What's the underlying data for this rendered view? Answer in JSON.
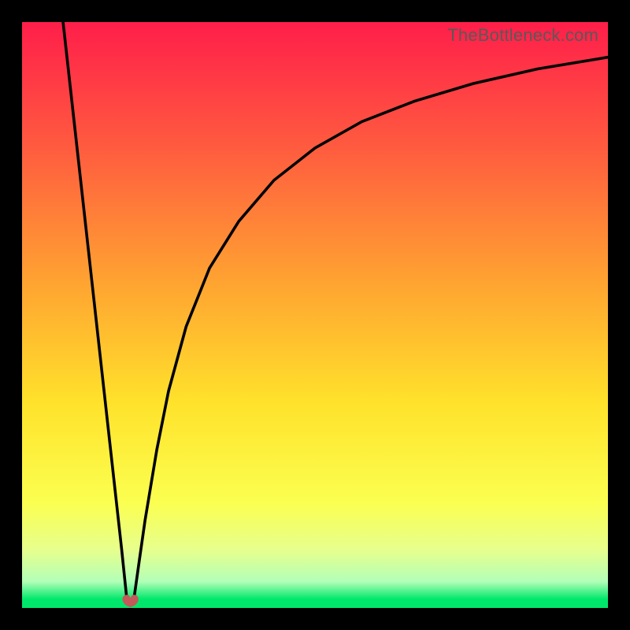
{
  "watermark": "TheBottleneck.com",
  "chart_data": {
    "type": "line",
    "title": "",
    "xlabel": "",
    "ylabel": "",
    "xlim": [
      0,
      100
    ],
    "ylim": [
      0,
      100
    ],
    "grid": false,
    "legend": false,
    "background_gradient": {
      "stops": [
        {
          "pos": 0.0,
          "color": "#ff1e4a"
        },
        {
          "pos": 0.2,
          "color": "#ff5740"
        },
        {
          "pos": 0.45,
          "color": "#ffa531"
        },
        {
          "pos": 0.65,
          "color": "#ffe22b"
        },
        {
          "pos": 0.82,
          "color": "#fbff50"
        },
        {
          "pos": 0.9,
          "color": "#e7ff8c"
        },
        {
          "pos": 0.955,
          "color": "#b3ffb8"
        },
        {
          "pos": 0.985,
          "color": "#00e86b"
        },
        {
          "pos": 1.0,
          "color": "#00e86b"
        }
      ]
    },
    "series": [
      {
        "name": "curve-left",
        "x": [
          7.0,
          8.0,
          9.0,
          10.0,
          11.0,
          12.0,
          13.0,
          14.0,
          15.0,
          16.0,
          17.0,
          17.8
        ],
        "y": [
          100,
          91,
          82,
          73,
          64,
          55,
          46,
          37,
          28,
          19,
          10,
          2.3
        ]
      },
      {
        "name": "curve-right",
        "x": [
          19.2,
          20,
          21,
          23,
          25,
          28,
          32,
          37,
          43,
          50,
          58,
          67,
          77,
          88,
          100
        ],
        "y": [
          2.3,
          8,
          15,
          27,
          37,
          48,
          58,
          66,
          73,
          78.5,
          83,
          86.5,
          89.5,
          92,
          94
        ]
      }
    ],
    "markers": [
      {
        "name": "min-marker",
        "x": 18.5,
        "y": 1.0,
        "shape": "heart",
        "color": "#c25a5a",
        "size": 22
      }
    ]
  }
}
